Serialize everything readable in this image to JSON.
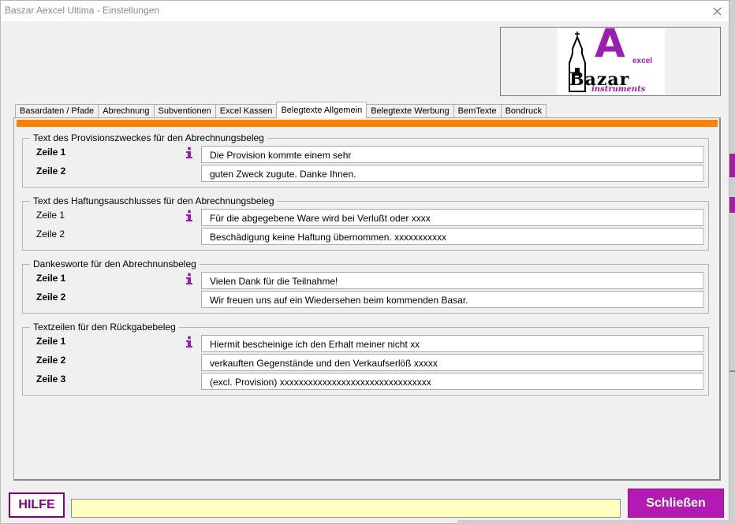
{
  "window": {
    "title": "Baszar Aexcel Ultima - Einstellungen",
    "close_glyph": "✕"
  },
  "logo": {
    "letter": "A",
    "excel": "excel",
    "name": "Bazar",
    "sub": "instruments"
  },
  "tabs": [
    {
      "label": "Basardaten / Pfade"
    },
    {
      "label": "Abrechnung"
    },
    {
      "label": "Subventionen"
    },
    {
      "label": "Excel Kassen"
    },
    {
      "label": "Belegtexte Allgemein"
    },
    {
      "label": "Belegtexte Werbung"
    },
    {
      "label": "BemTexte"
    },
    {
      "label": "Bondruck"
    }
  ],
  "active_tab": "Belegtexte Allgemein",
  "accent_color": "#ff8000",
  "info_icon_color": "#9a1fb0",
  "groups": [
    {
      "title": "Text des Provisionszweckes für den Abrechnungsbeleg",
      "rows": [
        {
          "label": "Zeile 1",
          "value": "Die Provision kommte einem sehr"
        },
        {
          "label": "Zeile 2",
          "value": "guten Zweck zugute. Danke Ihnen."
        }
      ]
    },
    {
      "title": "Text des Haftungsauschlusses für den Abrechnungsbeleg",
      "rows": [
        {
          "label": "Zeile 1",
          "value": "Für die abgegebene Ware wird bei Verlußt oder xxxx"
        },
        {
          "label": "Zeile 2",
          "value": "Beschädigung keine Haftung übernommen. xxxxxxxxxxx"
        }
      ]
    },
    {
      "title": "Dankesworte für den Abrechnunsbeleg",
      "rows": [
        {
          "label": "Zeile 1",
          "value": "Vielen Dank für die Teilnahme!"
        },
        {
          "label": "Zeile 2",
          "value": "Wir freuen uns auf ein Wiedersehen beim kommenden Basar."
        }
      ]
    },
    {
      "title": "Textzeilen für den Rückgabebeleg",
      "rows": [
        {
          "label": "Zeile 1",
          "value": "Hiermit bescheinige ich den Erhalt meiner nicht xx"
        },
        {
          "label": "Zeile 2",
          "value": "verkauften Gegenstände und den Verkaufserlöß xxxxx"
        },
        {
          "label": "Zeile 3",
          "value": "(excl. Provision)  xxxxxxxxxxxxxxxxxxxxxxxxxxxxxxxx"
        }
      ]
    }
  ],
  "footer": {
    "help_label": "HILFE",
    "status_text": "",
    "close_label": "Schließen"
  }
}
